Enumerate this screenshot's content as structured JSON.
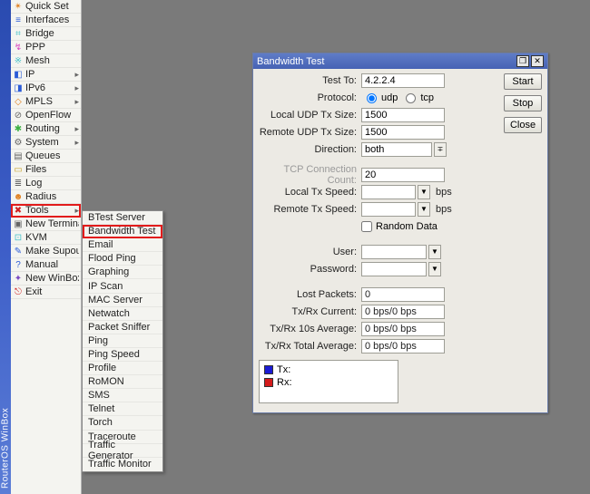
{
  "strip_text": "RouterOS WinBox",
  "sidebar": {
    "items": [
      {
        "icon": "✴",
        "cls": "c-orange",
        "label": "Quick Set",
        "expand": false
      },
      {
        "icon": "≡",
        "cls": "c-blue",
        "label": "Interfaces",
        "expand": false
      },
      {
        "icon": "⌗",
        "cls": "c-cyan",
        "label": "Bridge",
        "expand": false
      },
      {
        "icon": "↯",
        "cls": "c-mag",
        "label": "PPP",
        "expand": false
      },
      {
        "icon": "※",
        "cls": "c-cyan",
        "label": "Mesh",
        "expand": false
      },
      {
        "icon": "◧",
        "cls": "c-blue",
        "label": "IP",
        "expand": true
      },
      {
        "icon": "◨",
        "cls": "c-blue",
        "label": "IPv6",
        "expand": true
      },
      {
        "icon": "◇",
        "cls": "c-orange",
        "label": "MPLS",
        "expand": true
      },
      {
        "icon": "⊘",
        "cls": "c-gray",
        "label": "OpenFlow",
        "expand": false
      },
      {
        "icon": "✱",
        "cls": "c-green",
        "label": "Routing",
        "expand": true
      },
      {
        "icon": "⚙",
        "cls": "c-gray",
        "label": "System",
        "expand": true
      },
      {
        "icon": "▤",
        "cls": "c-gray",
        "label": "Queues",
        "expand": false
      },
      {
        "icon": "▭",
        "cls": "c-gold",
        "label": "Files",
        "expand": false
      },
      {
        "icon": "≣",
        "cls": "c-gray",
        "label": "Log",
        "expand": false
      },
      {
        "icon": "☻",
        "cls": "c-orange",
        "label": "Radius",
        "expand": false
      },
      {
        "icon": "✖",
        "cls": "c-red",
        "label": "Tools",
        "expand": true
      },
      {
        "icon": "▣",
        "cls": "c-gray",
        "label": "New Terminal",
        "expand": false
      },
      {
        "icon": "⊡",
        "cls": "c-cyan",
        "label": "KVM",
        "expand": false
      },
      {
        "icon": "✎",
        "cls": "c-blue",
        "label": "Make Supout.rif",
        "expand": false
      },
      {
        "icon": "?",
        "cls": "c-blue",
        "label": "Manual",
        "expand": false
      },
      {
        "icon": "✦",
        "cls": "c-purple",
        "label": "New WinBox",
        "expand": false
      },
      {
        "icon": "⎋",
        "cls": "c-red",
        "label": "Exit",
        "expand": false
      }
    ],
    "highlight_index": 15
  },
  "submenu": {
    "items": [
      "BTest Server",
      "Bandwidth Test",
      "Email",
      "Flood Ping",
      "Graphing",
      "IP Scan",
      "MAC Server",
      "Netwatch",
      "Packet Sniffer",
      "Ping",
      "Ping Speed",
      "Profile",
      "RoMON",
      "SMS",
      "Telnet",
      "Torch",
      "Traceroute",
      "Traffic Generator",
      "Traffic Monitor"
    ],
    "highlight_index": 1
  },
  "dialog": {
    "title": "Bandwidth Test",
    "buttons": {
      "start": "Start",
      "stop": "Stop",
      "close": "Close"
    },
    "labels": {
      "test_to": "Test To:",
      "protocol": "Protocol:",
      "local_udp": "Local UDP Tx Size:",
      "remote_udp": "Remote UDP Tx Size:",
      "direction": "Direction:",
      "tcp_conn": "TCP Connection Count:",
      "local_tx": "Local Tx Speed:",
      "remote_tx": "Remote Tx Speed:",
      "random": "Random Data",
      "user": "User:",
      "password": "Password:",
      "lost": "Lost Packets:",
      "txrx_cur": "Tx/Rx Current:",
      "txrx_avg": "Tx/Rx 10s Average:",
      "txrx_tot": "Tx/Rx Total Average:"
    },
    "values": {
      "test_to": "4.2.2.4",
      "proto_udp": "udp",
      "proto_tcp": "tcp",
      "local_udp": "1500",
      "remote_udp": "1500",
      "direction": "both",
      "tcp_conn": "20",
      "local_tx": "",
      "remote_tx": "",
      "tx_unit": "bps",
      "user": "",
      "password": "",
      "lost": "0",
      "txrx_cur": "0 bps/0 bps",
      "txrx_avg": "0 bps/0 bps",
      "txrx_tot": "0 bps/0 bps"
    },
    "legend": {
      "tx": "Tx:",
      "rx": "Rx:"
    }
  }
}
